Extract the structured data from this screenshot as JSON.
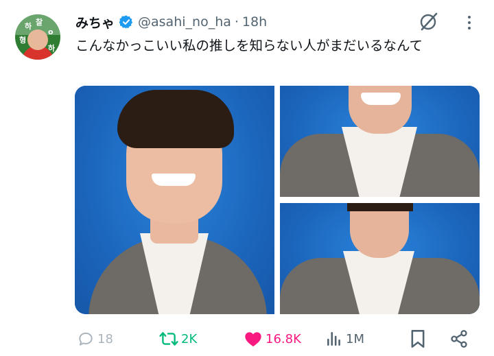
{
  "tweet": {
    "display_name": "みちゃ",
    "handle": "@asahi_no_ha",
    "separator": "·",
    "time": "18h",
    "text": "こんなかっこいい私の推しを知らない人がまだいるなんて",
    "avatar_glyphs": [
      "하",
      "찰",
      "형",
      "o",
      "하"
    ]
  },
  "media": {
    "count": 3,
    "background_color": "#1e6fc6"
  },
  "actions": {
    "replies": "18",
    "reposts": "2K",
    "likes": "16.8K",
    "views": "1M"
  },
  "colors": {
    "verified": "#1d9bf0",
    "repost": "#00ba7c",
    "like": "#f91880",
    "muted": "#536471"
  }
}
